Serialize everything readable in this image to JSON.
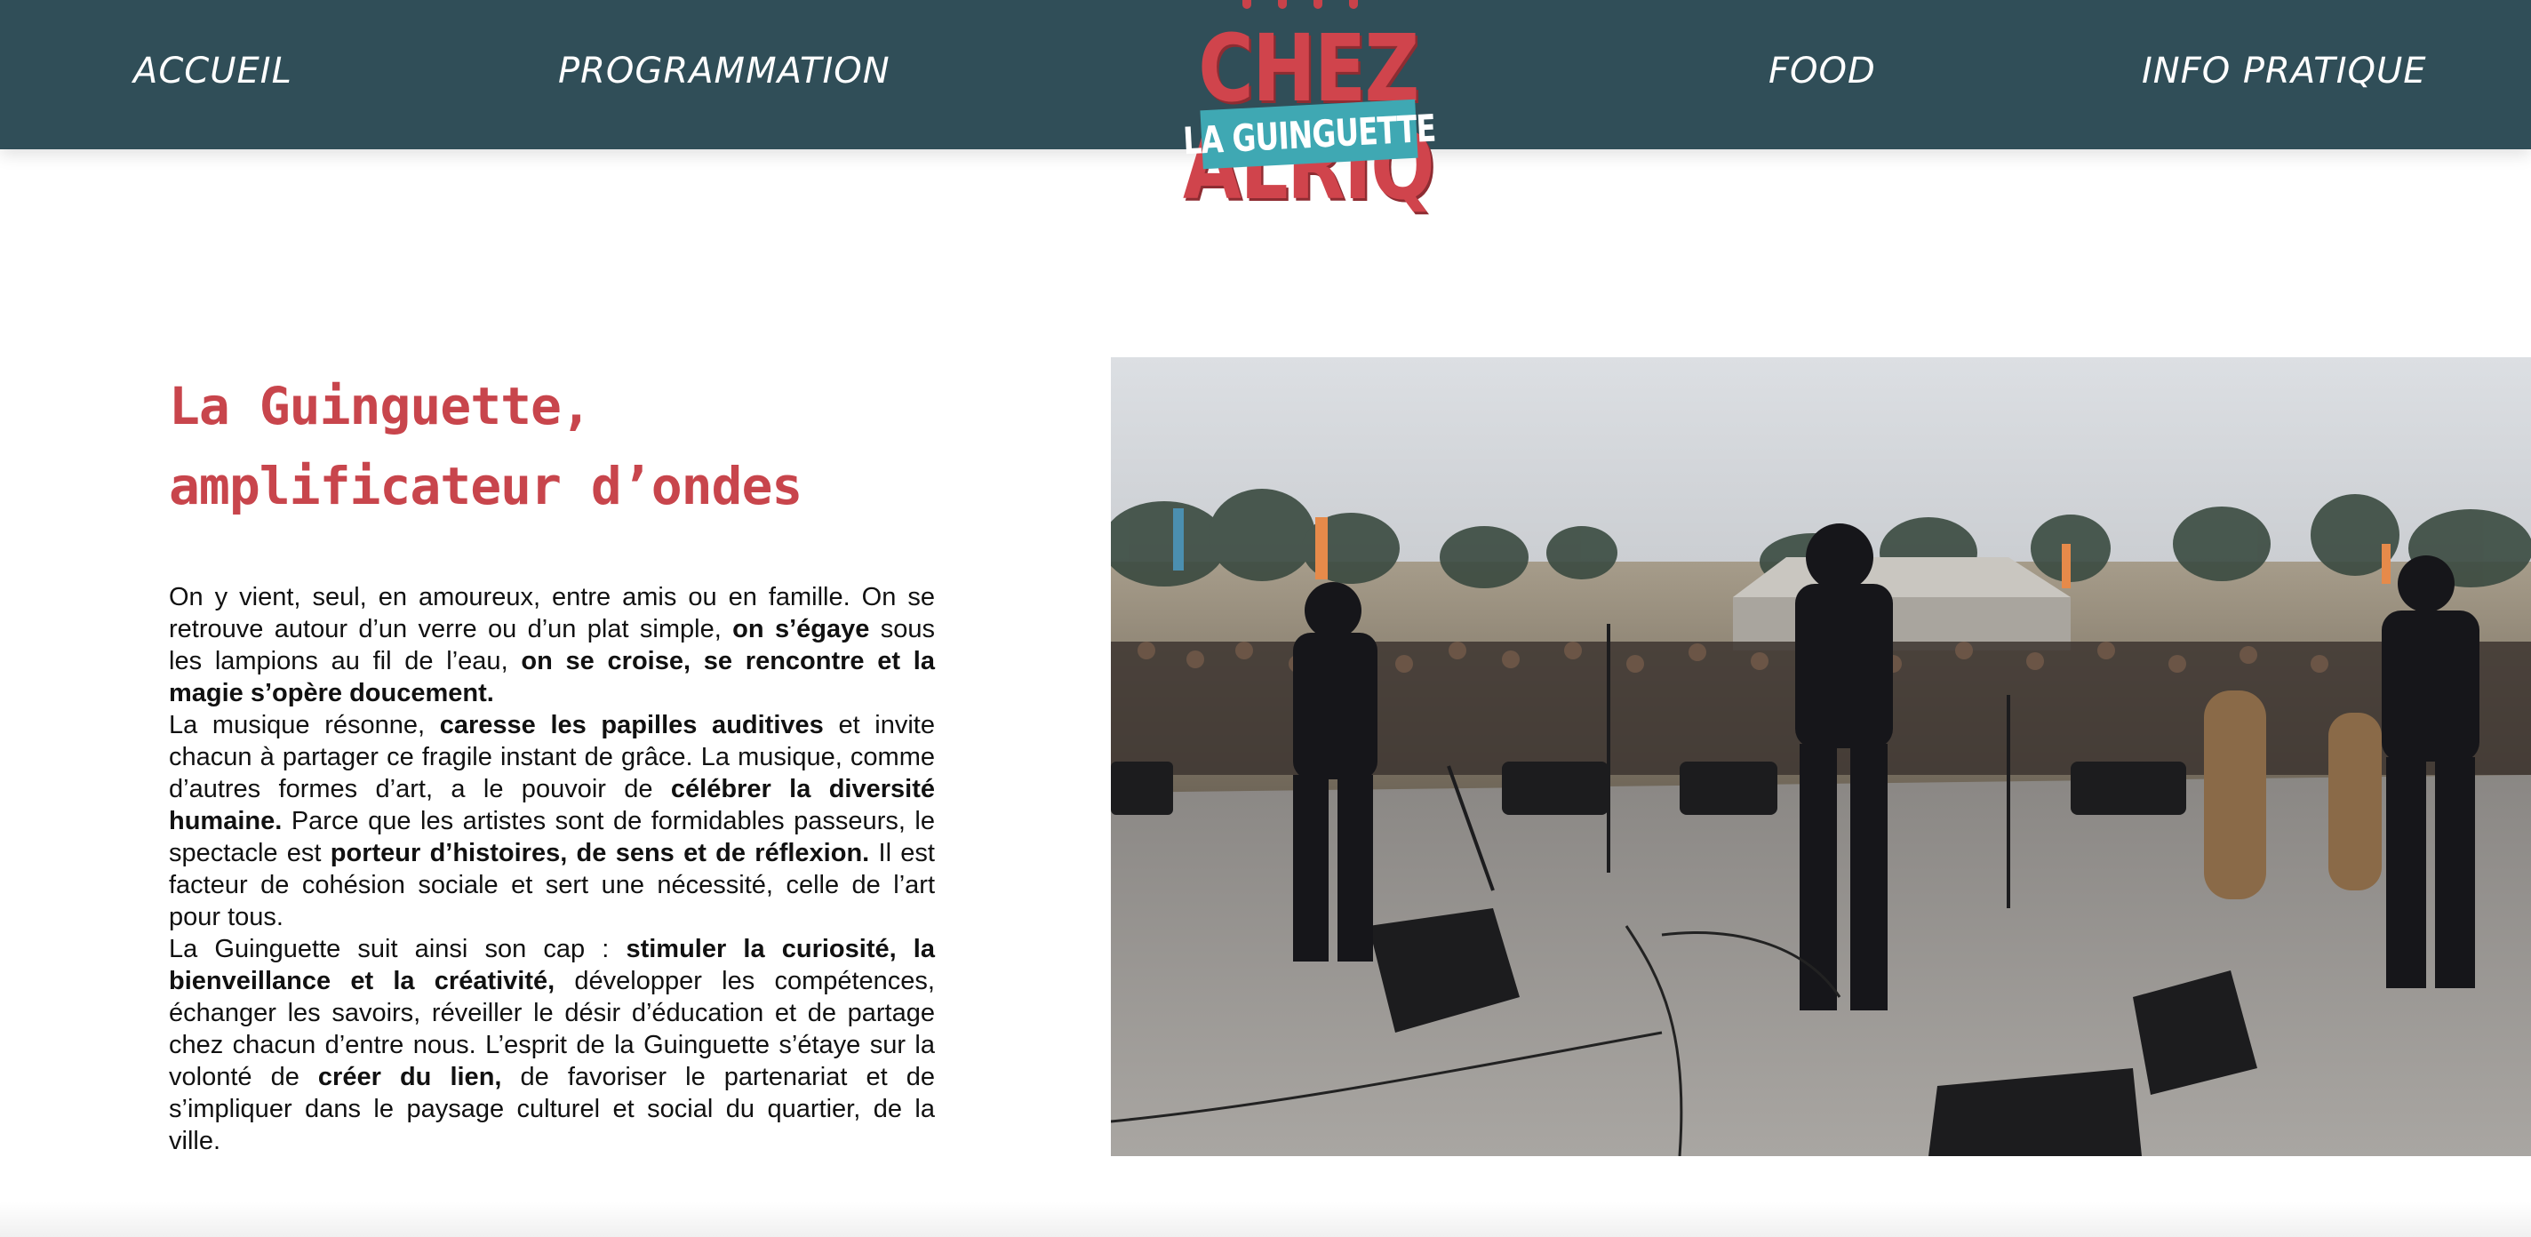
{
  "nav": {
    "accueil": "ACCUEIL",
    "programmation": "PROGRAMMATION",
    "food": "FOOD",
    "info_pratique": "INFO PRATIQUE"
  },
  "logo": {
    "main": "CHEZ ALRIQ",
    "badge": "LA GUINGUETTE"
  },
  "section": {
    "title_line1": "La Guinguette,",
    "title_line2": "amplificateur d’ondes",
    "p1": {
      "a": "On y vient, seul, en amoureux, entre amis ou en famille. On se retrouve autour d’un verre ou d’un plat simple, ",
      "b": "on s’égaye",
      "c": " sous les lampions au fil de l’eau, ",
      "d": "on se croise, se rencontre et la magie s’opère doucement."
    },
    "p2": {
      "a": "La musique résonne, ",
      "b": "caresse les papilles auditives",
      "c": " et invite chacun à partager ce fragile instant de grâce. La musique, comme d’autres formes d’art, a le pouvoir de ",
      "d": "célébrer la diversité humaine.",
      "e": " Parce que les artistes sont de formidables passeurs, le spectacle est ",
      "f": "porteur d’histoires, de sens et de réflexion.",
      "g": " Il est facteur de cohésion sociale et sert une nécessité, celle de l’art pour tous."
    },
    "p3": {
      "a": "La Guinguette suit ainsi son cap : ",
      "b": "stimuler la curiosité, la bienveillance et la créativité,",
      "c": " développer les compétences, échanger les savoirs, réveiller le désir d’éducation et de partage chez chacun d’entre nous. L’esprit de la Guinguette s’étaye sur la volonté de ",
      "d": "créer du lien,",
      "e": " de favoriser le partenariat et de s’impliquer dans le paysage culturel et social du quartier, de la ville."
    }
  },
  "colors": {
    "header_bg": "#304e58",
    "accent_red": "#c8454c",
    "badge_teal": "#3fa8b3"
  },
  "icons": {
    "photo": "concert-stage-photo"
  }
}
